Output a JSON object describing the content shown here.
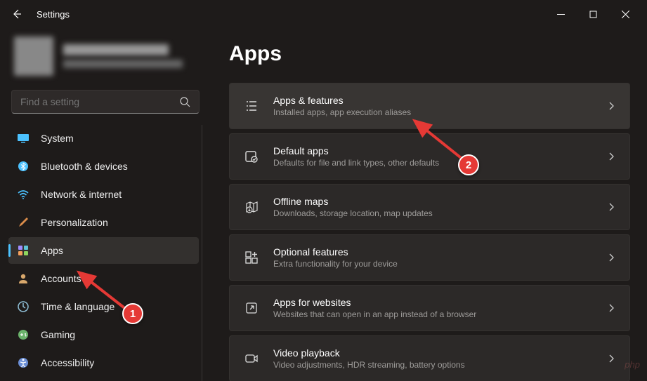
{
  "window": {
    "title": "Settings"
  },
  "search": {
    "placeholder": "Find a setting"
  },
  "nav": {
    "items": [
      {
        "key": "system",
        "label": "System"
      },
      {
        "key": "bluetooth",
        "label": "Bluetooth & devices"
      },
      {
        "key": "network",
        "label": "Network & internet"
      },
      {
        "key": "personalization",
        "label": "Personalization"
      },
      {
        "key": "apps",
        "label": "Apps"
      },
      {
        "key": "accounts",
        "label": "Accounts"
      },
      {
        "key": "time",
        "label": "Time & language"
      },
      {
        "key": "gaming",
        "label": "Gaming"
      },
      {
        "key": "accessibility",
        "label": "Accessibility"
      }
    ]
  },
  "page": {
    "title": "Apps"
  },
  "cards": [
    {
      "title": "Apps & features",
      "sub": "Installed apps, app execution aliases"
    },
    {
      "title": "Default apps",
      "sub": "Defaults for file and link types, other defaults"
    },
    {
      "title": "Offline maps",
      "sub": "Downloads, storage location, map updates"
    },
    {
      "title": "Optional features",
      "sub": "Extra functionality for your device"
    },
    {
      "title": "Apps for websites",
      "sub": "Websites that can open in an app instead of a browser"
    },
    {
      "title": "Video playback",
      "sub": "Video adjustments, HDR streaming, battery options"
    }
  ],
  "annotations": {
    "badge1": "1",
    "badge2": "2"
  },
  "watermark": "php"
}
